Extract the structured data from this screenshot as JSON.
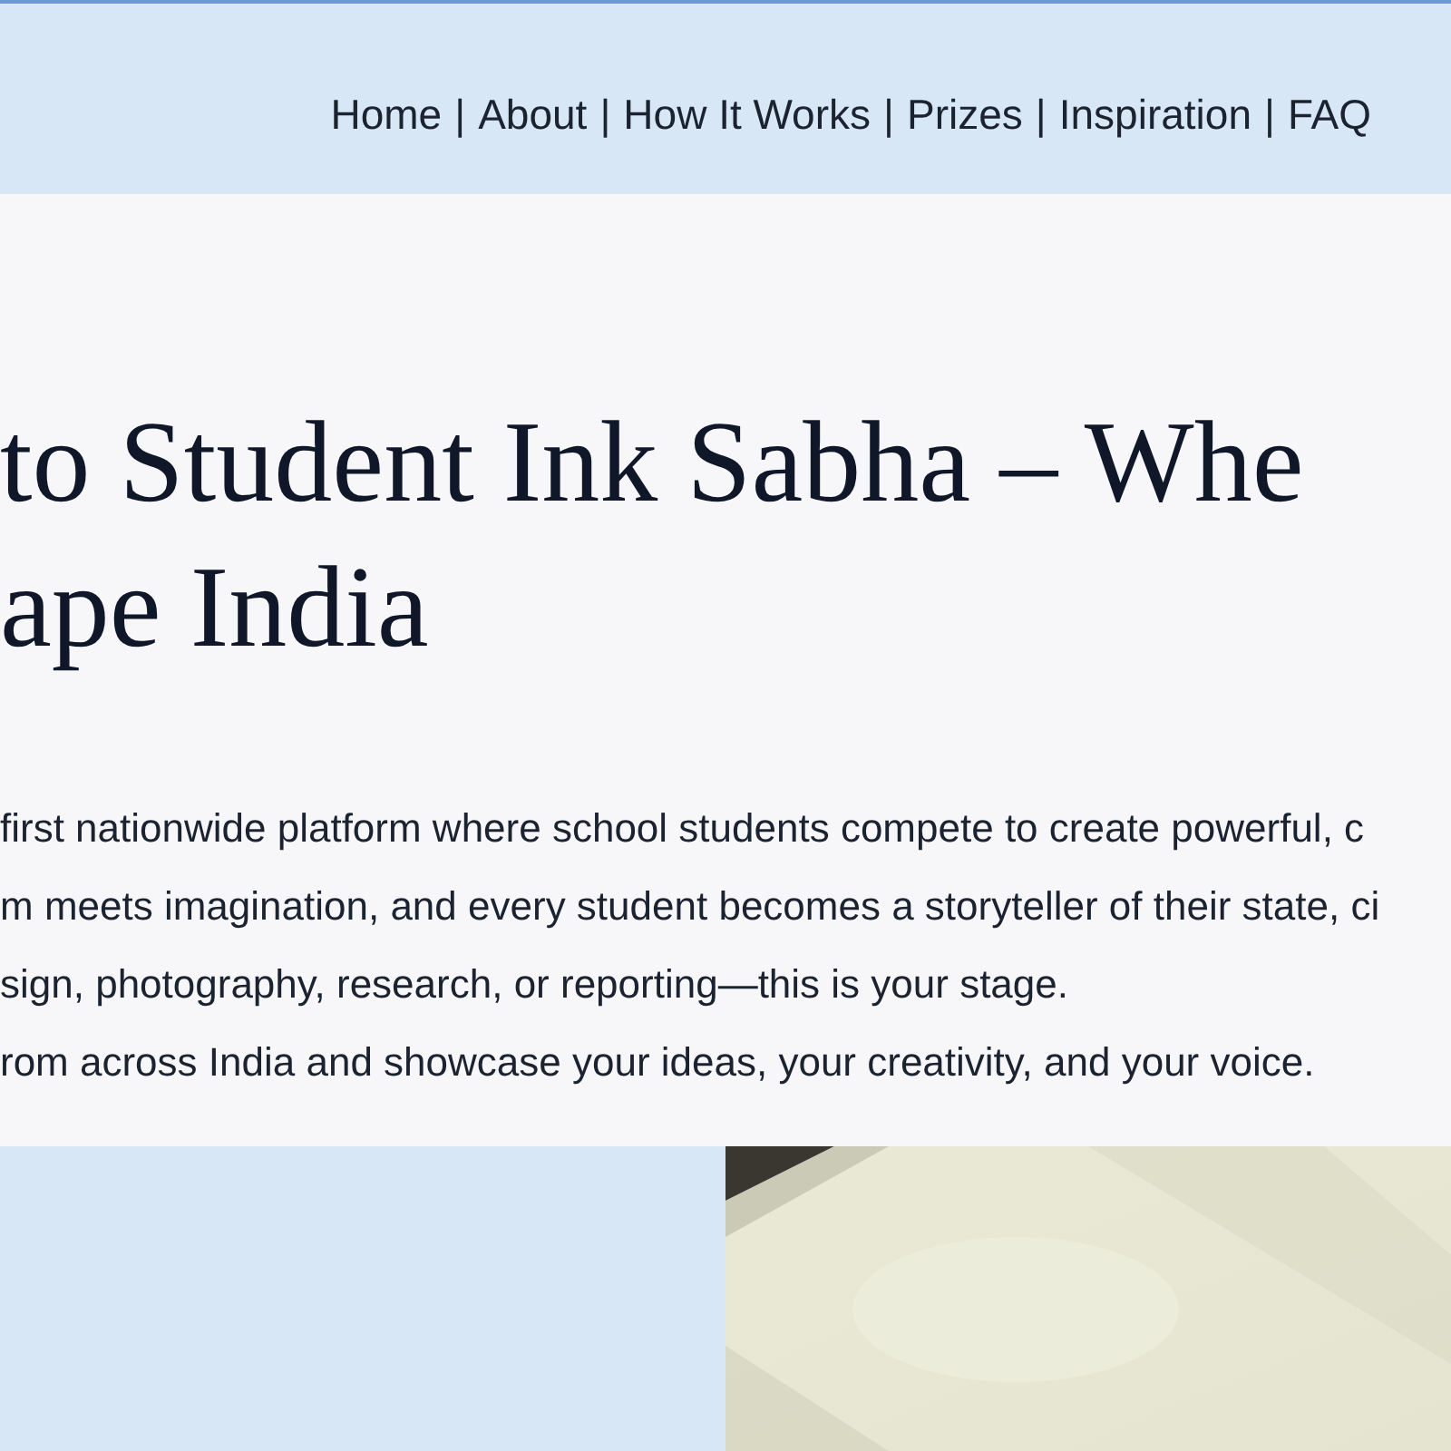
{
  "nav": {
    "links": [
      "Home",
      "About",
      "How It Works",
      "Prizes",
      "Inspiration",
      "FAQ"
    ],
    "separators": [
      "|",
      "|",
      "|",
      "|",
      "|"
    ]
  },
  "hero": {
    "heading_lines": [
      "to Student Ink Sabha – Whe",
      "ape India"
    ],
    "body_lines": [
      "first nationwide platform where school students compete to create powerful, c",
      "m meets imagination, and every student becomes a storyteller of their state, ci",
      "sign, photography, research, or reporting—this is your stage.",
      "rom across India and showcase your ideas, your creativity, and your voice."
    ]
  }
}
